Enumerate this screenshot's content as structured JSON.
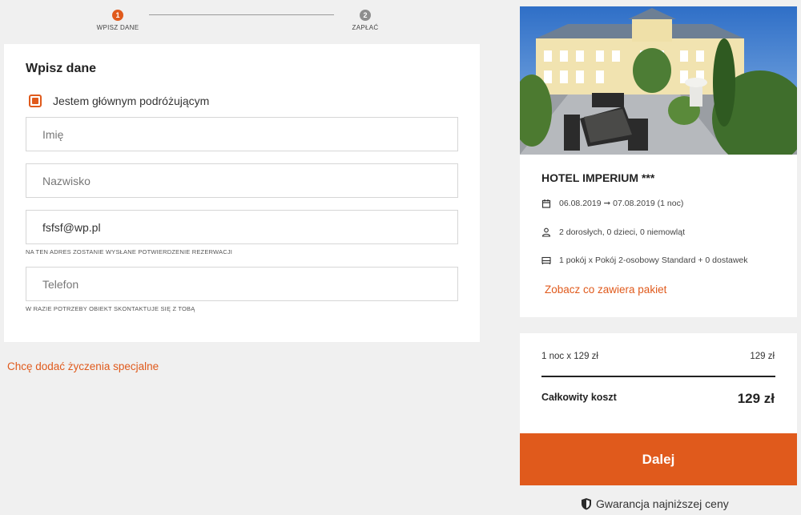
{
  "stepper": {
    "steps": [
      {
        "number": "1",
        "label": "WPISZ DANE"
      },
      {
        "number": "2",
        "label": "ZAPŁAĆ"
      }
    ]
  },
  "form": {
    "title": "Wpisz dane",
    "main_traveler_label": "Jestem głównym podróżującym",
    "first_name_placeholder": "Imię",
    "last_name_placeholder": "Nazwisko",
    "email_value": "fsfsf@wp.pl",
    "email_hint": "NA TEN ADRES ZOSTANIE WYSŁANE POTWIERDZENIE REZERWACJI",
    "phone_placeholder": "Telefon",
    "phone_hint": "W RAZIE POTRZEBY OBIEKT SKONTAKTUJE SIĘ Z TOBĄ"
  },
  "special_requests_link": "Chcę dodać życzenia specjalne",
  "hotel": {
    "name": "HOTEL IMPERIUM ***",
    "dates": "06.08.2019 ➞ 07.08.2019 (1 noc)",
    "guests": "2 dorosłych, 0 dzieci, 0 niemowląt",
    "room": "1 pokój x Pokój 2-osobowy Standard + 0 dostawek",
    "package_link": "Zobacz co zawiera pakiet"
  },
  "price": {
    "line_label": "1 noc x 129 zł",
    "line_value": "129 zł",
    "total_label": "Całkowity koszt",
    "total_value": "129 zł"
  },
  "next_button": "Dalej",
  "guarantee": "Gwarancja najniższej ceny",
  "colors": {
    "accent": "#e05a1c",
    "background": "#f0f0f0"
  },
  "icons": [
    "calendar-icon",
    "person-icon",
    "bed-icon",
    "shield-icon"
  ]
}
